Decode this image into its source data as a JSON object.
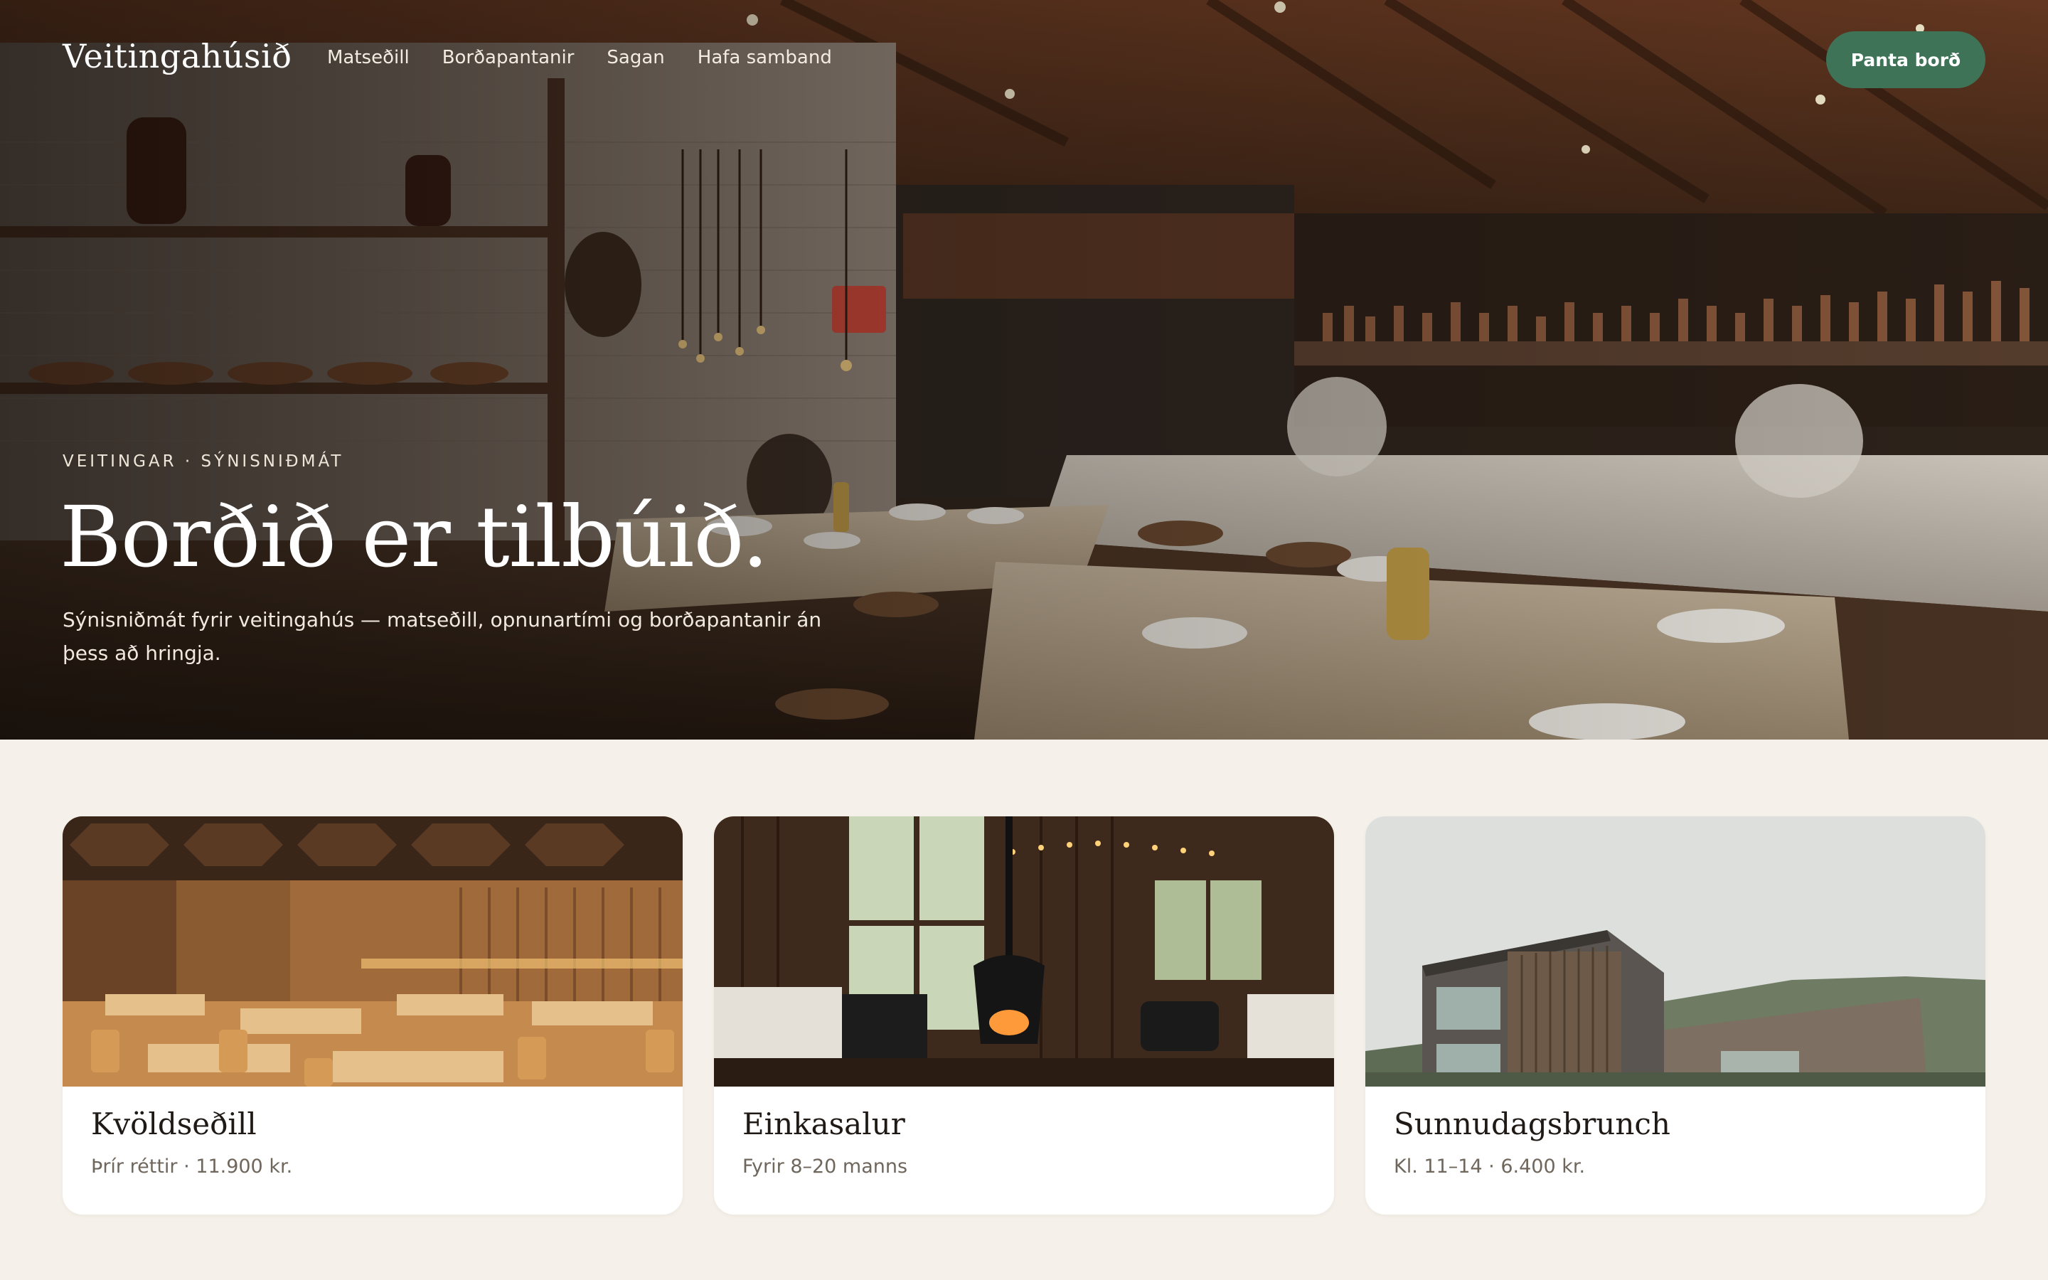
{
  "brand": "Veitingahúsið",
  "nav": {
    "items": [
      {
        "label": "Matseðill"
      },
      {
        "label": "Borðapantanir"
      },
      {
        "label": "Sagan"
      },
      {
        "label": "Hafa samband"
      }
    ]
  },
  "cta": {
    "label": "Panta borð"
  },
  "hero": {
    "eyebrow": "VEITINGAR · SÝNISNIÐMÁT",
    "title": "Borðið er tilbúið.",
    "subtitle": "Sýnisniðmát fyrir veitingahús — matseðill, opnunartími og borðapantanir án þess að hringja.",
    "image": "restaurant-interior-photo"
  },
  "cards": [
    {
      "title": "Kvöldseðill",
      "meta": "Þrír réttir · 11.900 kr.",
      "image": "dining-room-photo"
    },
    {
      "title": "Einkasalur",
      "meta": "Fyrir 8–20 manns",
      "image": "cabin-fireplace-photo"
    },
    {
      "title": "Sunnudagsbrunch",
      "meta": "Kl. 11–14 · 6.400 kr.",
      "image": "wooden-house-photo"
    }
  ],
  "colors": {
    "accent": "#3f7358",
    "page_background": "#f5f1ea",
    "card_background": "#ffffff",
    "text_dark": "#1f1a16",
    "text_muted": "#6f665c"
  }
}
